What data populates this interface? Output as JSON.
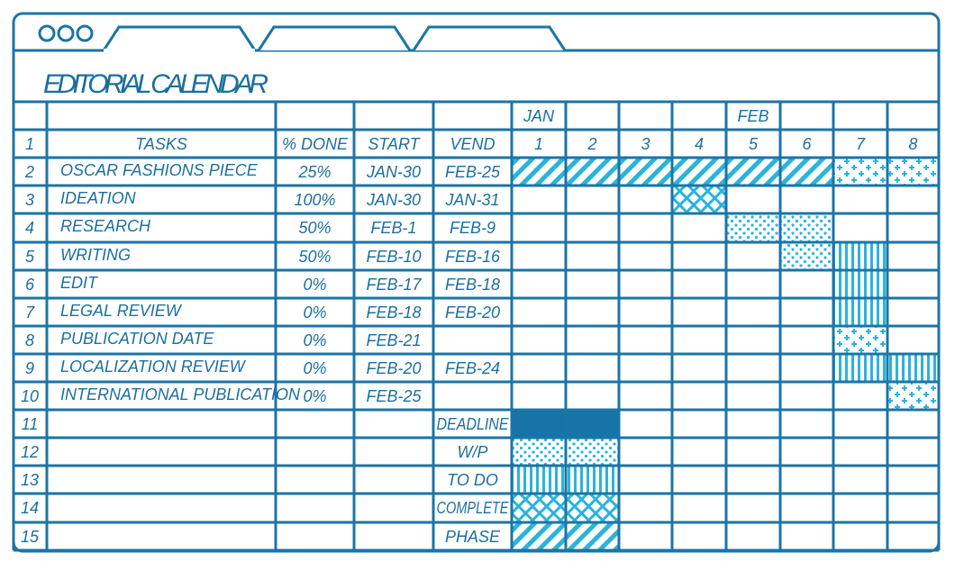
{
  "window": {
    "tabs": [
      "",
      "",
      ""
    ]
  },
  "title": "EDITORIAL CALENDAR",
  "colors": {
    "line": "#1b75a6",
    "pattern": "#2ab4da",
    "deadline": "#1674a8",
    "text": "#1b6f9e"
  },
  "months": [
    {
      "label": "JAN",
      "day": 1
    },
    {
      "label": "FEB",
      "day": 5
    }
  ],
  "header": {
    "tasks": "TASKS",
    "done": "% DONE",
    "start": "START",
    "end": "VEND"
  },
  "days": [
    "1",
    "2",
    "3",
    "4",
    "5",
    "6",
    "7",
    "8"
  ],
  "row_numbers": [
    "1",
    "2",
    "3",
    "4",
    "5",
    "6",
    "7",
    "8",
    "9",
    "10",
    "11",
    "12",
    "13",
    "14",
    "15"
  ],
  "tasks": [
    {
      "name": "OSCAR FASHIONS PIECE",
      "done": "25%",
      "start": "JAN-30",
      "end": "FEB-25"
    },
    {
      "name": "IDEATION",
      "done": "100%",
      "start": "JAN-30",
      "end": "JAN-31"
    },
    {
      "name": "RESEARCH",
      "done": "50%",
      "start": "FEB-1",
      "end": "FEB-9"
    },
    {
      "name": "WRITING",
      "done": "50%",
      "start": "FEB-10",
      "end": "FEB-16"
    },
    {
      "name": "EDIT",
      "done": "0%",
      "start": "FEB-17",
      "end": "FEB-18"
    },
    {
      "name": "LEGAL REVIEW",
      "done": "0%",
      "start": "FEB-18",
      "end": "FEB-20"
    },
    {
      "name": "PUBLICATION DATE",
      "done": "0%",
      "start": "FEB-21",
      "end": ""
    },
    {
      "name": "LOCALIZATION REVIEW",
      "done": "0%",
      "start": "FEB-20",
      "end": "FEB-24"
    },
    {
      "name": "INTERNATIONAL PUBLICATION",
      "done": "0%",
      "start": "FEB-25",
      "end": ""
    }
  ],
  "gantt": [
    {
      "task": 0,
      "from": 1,
      "to": 6,
      "pattern": "phase"
    },
    {
      "task": 0,
      "from": 7,
      "to": 8,
      "pattern": "cross"
    },
    {
      "task": 1,
      "from": 4,
      "to": 4,
      "pattern": "complete"
    },
    {
      "task": 2,
      "from": 5,
      "to": 6,
      "pattern": "wp"
    },
    {
      "task": 3,
      "from": 6,
      "to": 6,
      "pattern": "wp"
    },
    {
      "task": 3,
      "from": 7,
      "to": 7,
      "pattern": "todo"
    },
    {
      "task": 4,
      "from": 7,
      "to": 7,
      "pattern": "todo"
    },
    {
      "task": 5,
      "from": 7,
      "to": 7,
      "pattern": "todo"
    },
    {
      "task": 6,
      "from": 7,
      "to": 7,
      "pattern": "cross"
    },
    {
      "task": 7,
      "from": 7,
      "to": 8,
      "pattern": "todo"
    },
    {
      "task": 8,
      "from": 8,
      "to": 8,
      "pattern": "cross"
    }
  ],
  "legend": [
    {
      "label": "DEADLINE",
      "pattern": "deadline"
    },
    {
      "label": "W/P",
      "pattern": "wp"
    },
    {
      "label": "TO DO",
      "pattern": "todo"
    },
    {
      "label": "COMPLETE",
      "pattern": "complete"
    },
    {
      "label": "PHASE",
      "pattern": "phase"
    }
  ]
}
